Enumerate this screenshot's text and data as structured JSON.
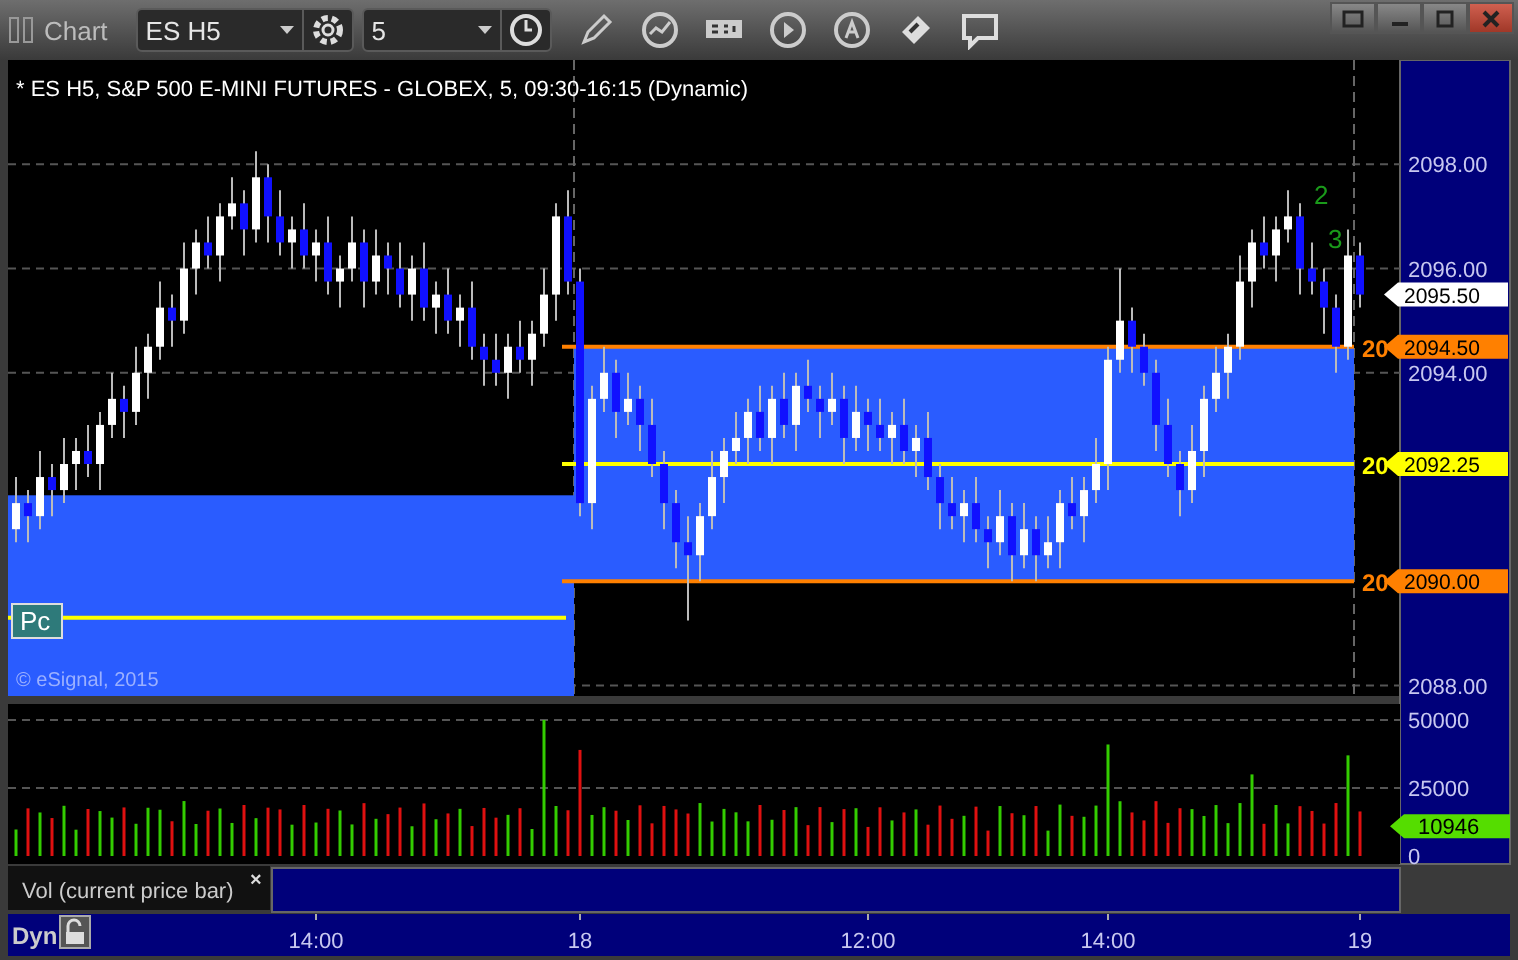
{
  "window": {
    "title": "Chart"
  },
  "toolbar": {
    "symbol": "ES H5",
    "interval": "5"
  },
  "chart": {
    "title": "* ES H5, S&P 500 E-MINI FUTURES - GLOBEX, 5, 09:30-16:15 (Dynamic)",
    "chart_data": {
      "type": "candlestick",
      "yticks": [
        {
          "value": 2098,
          "label": "2098.00"
        },
        {
          "value": 2096,
          "label": "2096.00"
        },
        {
          "value": 2094,
          "label": "2094.00"
        },
        {
          "value": 2088,
          "label": "2088.00"
        }
      ],
      "ylim": [
        2087.8,
        2100
      ],
      "grid": true,
      "ohlc": [
        [
          2091,
          2092,
          2090.75,
          2091.5
        ],
        [
          2091.5,
          2091.75,
          2090.75,
          2091.25
        ],
        [
          2091.25,
          2092.5,
          2091,
          2092
        ],
        [
          2092,
          2092.25,
          2091.25,
          2091.75
        ],
        [
          2091.75,
          2092.75,
          2091.5,
          2092.25
        ],
        [
          2092.25,
          2092.75,
          2091.75,
          2092.5
        ],
        [
          2092.5,
          2093,
          2092,
          2092.25
        ],
        [
          2092.25,
          2093.25,
          2091.75,
          2093
        ],
        [
          2093,
          2094,
          2092.75,
          2093.5
        ],
        [
          2093.5,
          2093.75,
          2092.75,
          2093.25
        ],
        [
          2093.25,
          2094.5,
          2093,
          2094
        ],
        [
          2094,
          2094.75,
          2093.5,
          2094.5
        ],
        [
          2094.5,
          2095.75,
          2094.25,
          2095.25
        ],
        [
          2095.25,
          2095.5,
          2094.5,
          2095
        ],
        [
          2095,
          2096.5,
          2094.75,
          2096
        ],
        [
          2096,
          2096.75,
          2095.5,
          2096.5
        ],
        [
          2096.5,
          2097,
          2096,
          2096.25
        ],
        [
          2096.25,
          2097.25,
          2095.75,
          2097
        ],
        [
          2097,
          2097.75,
          2096.75,
          2097.25
        ],
        [
          2097.25,
          2097.5,
          2096.25,
          2096.75
        ],
        [
          2096.75,
          2098.25,
          2096.5,
          2097.75
        ],
        [
          2097.75,
          2098,
          2096.5,
          2097
        ],
        [
          2097,
          2097.5,
          2096.25,
          2096.5
        ],
        [
          2096.5,
          2097,
          2096,
          2096.75
        ],
        [
          2096.75,
          2097.25,
          2096,
          2096.25
        ],
        [
          2096.25,
          2096.75,
          2095.75,
          2096.5
        ],
        [
          2096.5,
          2097,
          2095.5,
          2095.75
        ],
        [
          2095.75,
          2096.25,
          2095.25,
          2096
        ],
        [
          2096,
          2097,
          2095.75,
          2096.5
        ],
        [
          2096.5,
          2096.75,
          2095.25,
          2095.75
        ],
        [
          2095.75,
          2096.75,
          2095.5,
          2096.25
        ],
        [
          2096.25,
          2096.5,
          2095.5,
          2096
        ],
        [
          2096,
          2096.5,
          2095.25,
          2095.5
        ],
        [
          2095.5,
          2096.25,
          2095,
          2096
        ],
        [
          2096,
          2096.5,
          2095,
          2095.25
        ],
        [
          2095.25,
          2095.75,
          2094.75,
          2095.5
        ],
        [
          2095.5,
          2096,
          2094.75,
          2095
        ],
        [
          2095,
          2095.5,
          2094.5,
          2095.25
        ],
        [
          2095.25,
          2095.75,
          2094.25,
          2094.5
        ],
        [
          2094.5,
          2094.75,
          2093.75,
          2094.25
        ],
        [
          2094.25,
          2094.75,
          2093.75,
          2094
        ],
        [
          2094,
          2094.75,
          2093.5,
          2094.5
        ],
        [
          2094.5,
          2095,
          2094,
          2094.25
        ],
        [
          2094.25,
          2095,
          2093.75,
          2094.75
        ],
        [
          2094.75,
          2096,
          2094.5,
          2095.5
        ],
        [
          2095.5,
          2097.25,
          2095,
          2097
        ],
        [
          2097,
          2097.5,
          2095.5,
          2095.75
        ],
        [
          2095.75,
          2096,
          2091.25,
          2091.5
        ],
        [
          2091.5,
          2093.75,
          2091,
          2093.5
        ],
        [
          2093.5,
          2094.5,
          2093.25,
          2094
        ],
        [
          2094,
          2094.25,
          2092.75,
          2093.25
        ],
        [
          2093.25,
          2094,
          2093,
          2093.5
        ],
        [
          2093.5,
          2093.75,
          2092.5,
          2093
        ],
        [
          2093,
          2093.5,
          2092,
          2092.25
        ],
        [
          2092.25,
          2092.5,
          2091,
          2091.5
        ],
        [
          2091.5,
          2091.75,
          2090.25,
          2090.75
        ],
        [
          2090.75,
          2091.25,
          2089.25,
          2090.5
        ],
        [
          2090.5,
          2091.5,
          2090,
          2091.25
        ],
        [
          2091.25,
          2092.5,
          2091,
          2092
        ],
        [
          2092,
          2092.75,
          2091.5,
          2092.5
        ],
        [
          2092.5,
          2093.25,
          2092.25,
          2092.75
        ],
        [
          2092.75,
          2093.5,
          2092.25,
          2093.25
        ],
        [
          2093.25,
          2093.75,
          2092.5,
          2092.75
        ],
        [
          2092.75,
          2093.75,
          2092.25,
          2093.5
        ],
        [
          2093.5,
          2094,
          2092.75,
          2093
        ],
        [
          2093,
          2094,
          2092.5,
          2093.75
        ],
        [
          2093.75,
          2094.25,
          2093.25,
          2093.5
        ],
        [
          2093.5,
          2093.75,
          2092.75,
          2093.25
        ],
        [
          2093.25,
          2094,
          2093,
          2093.5
        ],
        [
          2093.5,
          2093.75,
          2092.25,
          2092.75
        ],
        [
          2092.75,
          2093.75,
          2092.5,
          2093.25
        ],
        [
          2093.25,
          2093.5,
          2092.5,
          2093
        ],
        [
          2093,
          2093.5,
          2092.5,
          2092.75
        ],
        [
          2092.75,
          2093.25,
          2092.25,
          2093
        ],
        [
          2093,
          2093.5,
          2092.25,
          2092.5
        ],
        [
          2092.5,
          2093,
          2092,
          2092.75
        ],
        [
          2092.75,
          2093.25,
          2091.75,
          2092
        ],
        [
          2092,
          2092.25,
          2091,
          2091.5
        ],
        [
          2091.5,
          2092,
          2091,
          2091.25
        ],
        [
          2091.25,
          2091.75,
          2090.75,
          2091.5
        ],
        [
          2091.5,
          2092,
          2090.75,
          2091
        ],
        [
          2091,
          2091.25,
          2090.25,
          2090.75
        ],
        [
          2090.75,
          2091.75,
          2090.5,
          2091.25
        ],
        [
          2091.25,
          2091.5,
          2090,
          2090.5
        ],
        [
          2090.5,
          2091.5,
          2090.25,
          2091
        ],
        [
          2091,
          2091.25,
          2090,
          2090.5
        ],
        [
          2090.5,
          2091.25,
          2090.25,
          2090.75
        ],
        [
          2090.75,
          2091.75,
          2090.25,
          2091.5
        ],
        [
          2091.5,
          2092,
          2091,
          2091.25
        ],
        [
          2091.25,
          2092,
          2090.75,
          2091.75
        ],
        [
          2091.75,
          2092.75,
          2091.5,
          2092.25
        ],
        [
          2092.25,
          2094.5,
          2091.75,
          2094.25
        ],
        [
          2094.25,
          2096,
          2094,
          2095
        ],
        [
          2095,
          2095.25,
          2094,
          2094.5
        ],
        [
          2094.5,
          2094.75,
          2093.75,
          2094
        ],
        [
          2094,
          2094.25,
          2092.5,
          2093
        ],
        [
          2093,
          2093.5,
          2092,
          2092.25
        ],
        [
          2092.25,
          2092.5,
          2091.25,
          2091.75
        ],
        [
          2091.75,
          2093,
          2091.5,
          2092.5
        ],
        [
          2092.5,
          2093.75,
          2092,
          2093.5
        ],
        [
          2093.5,
          2094.5,
          2093.25,
          2094
        ],
        [
          2094,
          2094.75,
          2093.5,
          2094.5
        ],
        [
          2094.5,
          2096.25,
          2094.25,
          2095.75
        ],
        [
          2095.75,
          2096.75,
          2095.25,
          2096.5
        ],
        [
          2096.5,
          2097,
          2096,
          2096.25
        ],
        [
          2096.25,
          2097,
          2095.75,
          2096.75
        ],
        [
          2096.75,
          2097.5,
          2096.5,
          2097
        ],
        [
          2097,
          2097.25,
          2095.5,
          2096
        ],
        [
          2096,
          2096.5,
          2095.5,
          2095.75
        ],
        [
          2095.75,
          2096,
          2094.75,
          2095.25
        ],
        [
          2095.25,
          2095.5,
          2094,
          2094.5
        ],
        [
          2094.5,
          2096.75,
          2094.25,
          2096.25
        ],
        [
          2096.25,
          2096.5,
          2095.25,
          2095.5
        ]
      ]
    },
    "level_labels": [
      {
        "text": "20",
        "color": "#ff8000"
      },
      {
        "text": "20",
        "color": "#ffff00"
      },
      {
        "text": "20",
        "color": "#ff8000"
      }
    ],
    "price_tags": [
      {
        "label": "2095.50",
        "color": "#ffffff"
      },
      {
        "label": "2094.50",
        "color": "#ff8000"
      },
      {
        "label": "2092.25",
        "color": "#ffff00"
      },
      {
        "label": "2090.00",
        "color": "#ff8000"
      }
    ],
    "markers": [
      "2",
      "3"
    ],
    "badge": "Pc",
    "copyright": "© eSignal, 2015"
  },
  "volume": {
    "ticks": [
      "50000",
      "25000",
      "0"
    ],
    "tag": "10946",
    "legend": "Vol (current price bar)",
    "close": "×"
  },
  "time_axis": {
    "mode": "Dyn",
    "labels": [
      "14:00",
      "18",
      "12:00",
      "14:00",
      "19"
    ]
  }
}
